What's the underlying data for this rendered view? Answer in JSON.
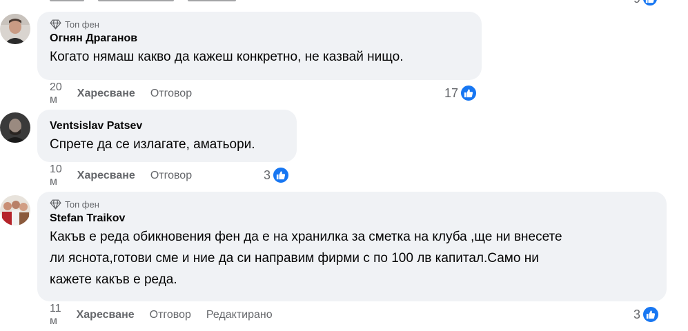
{
  "top_partial": {
    "count": "9"
  },
  "comments": [
    {
      "badge": "Топ фен",
      "author": "Огнян Драганов",
      "text": "Когато нямаш какво да кажеш конкретно, не казвай нищо.",
      "time": "20 м",
      "like_label": "Харесване",
      "reply_label": "Отговор",
      "edited_label": "",
      "reactions": "17"
    },
    {
      "badge": "",
      "author": "Ventsislav Patsev",
      "text": "Спрете да се излагате, аматьори.",
      "time": "10 м",
      "like_label": "Харесване",
      "reply_label": "Отговор",
      "edited_label": "",
      "reactions": "3"
    },
    {
      "badge": "Топ фен",
      "author": "Stefan Traikov",
      "text_lines": [
        "Какъв е реда обикновения фен да е на хранилка за сметка на клуба ,ще ни внесете",
        "ли яснота,готови сме и ние да си направим фирми с по 100 лв капитал.Само ни",
        "кажете какъв е реда."
      ],
      "time": "11 м",
      "like_label": "Харесване",
      "reply_label": "Отговор",
      "edited_label": "Редактирано",
      "reactions": "3"
    }
  ],
  "colors": {
    "bubble": "#f0f2f5",
    "meta": "#65676b",
    "like_blue": "#1877f2"
  },
  "icons": {
    "badge": "diamond-icon",
    "reaction": "thumbs-up-icon"
  }
}
